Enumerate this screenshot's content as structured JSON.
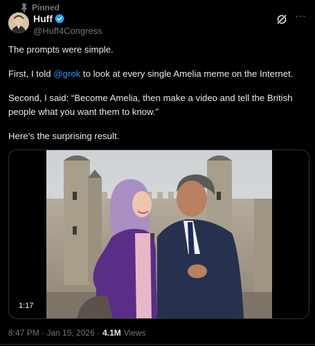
{
  "pinned": {
    "label": "Pinned"
  },
  "author": {
    "name": "Huff",
    "handle": "@Huff4Congress"
  },
  "tweet": {
    "line1": "The prompts were simple.",
    "line2_pre": "First, I told ",
    "line2_mention": "@grok",
    "line2_post": " to look at every single Amelia meme on the Internet.",
    "line3": "Second, I said: “Become Amelia, then make a video and tell the British people what you want them to know.”",
    "line4": "Here’s the surprising result."
  },
  "media": {
    "duration": "1:17"
  },
  "meta": {
    "timestamp": "8:47 PM · Jan 15, 2026 ·",
    "views_count": "4.1M",
    "views_label": "Views"
  },
  "colors": {
    "accent": "#1d9bf0",
    "muted": "#71767b",
    "text": "#e7e9ea",
    "background": "#000000"
  }
}
